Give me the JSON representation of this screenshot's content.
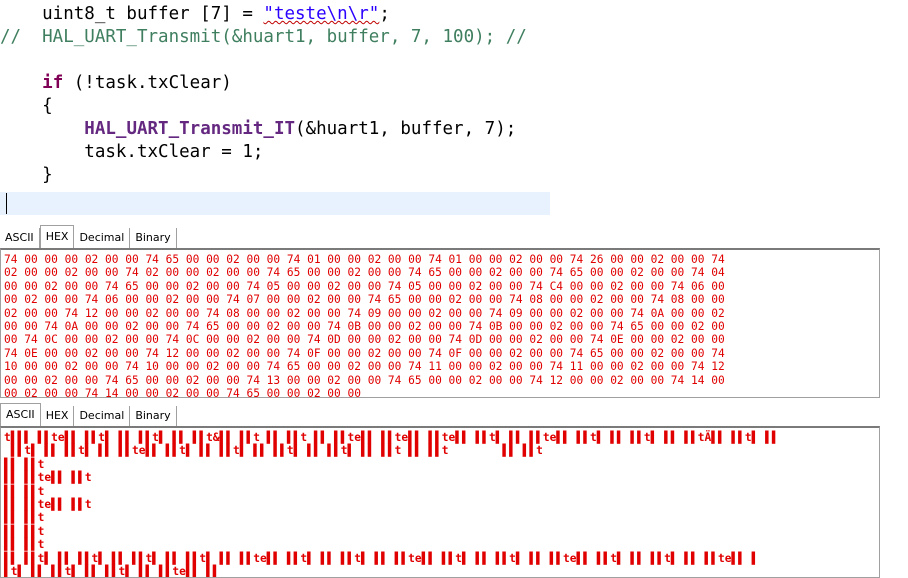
{
  "editor": {
    "lines": [
      [
        {
          "t": "    uint8_t buffer [7] = ",
          "c": "plain"
        },
        {
          "t": "\"teste\\n\\r\"",
          "c": "str-sq"
        },
        {
          "t": ";",
          "c": "plain"
        }
      ],
      [
        {
          "t": "//  HAL_UART_Transmit(&huart1, buffer, 7, 100); //",
          "c": "comment"
        }
      ],
      [
        {
          "t": "",
          "c": "plain"
        }
      ],
      [
        {
          "t": "    ",
          "c": "plain"
        },
        {
          "t": "if",
          "c": "kw"
        },
        {
          "t": " (!task.txClear)",
          "c": "plain"
        }
      ],
      [
        {
          "t": "    {",
          "c": "plain"
        }
      ],
      [
        {
          "t": "        ",
          "c": "plain"
        },
        {
          "t": "HAL_UART_Transmit_IT",
          "c": "fn"
        },
        {
          "t": "(&huart1, buffer, 7);",
          "c": "plain"
        }
      ],
      [
        {
          "t": "        task.txClear = 1;",
          "c": "plain"
        }
      ],
      [
        {
          "t": "    }",
          "c": "plain"
        }
      ],
      [
        {
          "t": "",
          "c": "plain"
        }
      ]
    ]
  },
  "hex_panel": {
    "tabs": [
      "ASCII",
      "HEX",
      "Decimal",
      "Binary"
    ],
    "active_tab": "HEX",
    "lines": [
      "74 00 00 00 02 00 00 74 65 00 00 02 00 00 74 01 00 00 02 00 00 74 01 00 00 02 00 00 74 26 00 00 02 00 00 74",
      "02 00 00 02 00 00 74 02 00 00 02 00 00 74 65 00 00 02 00 00 74 65 00 00 02 00 00 74 65 00 00 02 00 00 74 04",
      "00 00 02 00 00 74 65 00 00 02 00 00 74 05 00 00 02 00 00 74 05 00 00 02 00 00 74 C4 00 00 02 00 00 74 06 00",
      "00 02 00 00 74 06 00 00 02 00 00 74 07 00 00 02 00 00 74 65 00 00 02 00 00 74 08 00 00 02 00 00 74 08 00 00",
      "02 00 00 74 12 00 00 02 00 00 74 08 00 00 02 00 00 74 09 00 00 02 00 00 74 09 00 00 02 00 00 74 0A 00 00 02",
      "00 00 74 0A 00 00 02 00 00 74 65 00 00 02 00 00 74 0B 00 00 02 00 00 74 0B 00 00 02 00 00 74 65 00 00 02 00",
      "00 74 0C 00 00 02 00 00 74 0C 00 00 02 00 00 74 0D 00 00 02 00 00 74 0D 00 00 02 00 00 74 0E 00 00 02 00 00",
      "74 0E 00 00 02 00 00 74 12 00 00 02 00 00 74 0F 00 00 02 00 00 74 0F 00 00 02 00 00 74 65 00 00 02 00 00 74",
      "10 00 00 02 00 00 74 10 00 00 02 00 00 74 65 00 00 02 00 00 74 11 00 00 02 00 00 74 11 00 00 02 00 00 74 12",
      "00 00 02 00 00 74 65 00 00 02 00 00 74 13 00 00 02 00 00 74 65 00 00 02 00 00 74 12 00 00 02 00 00 74 14 00",
      "00 02 00 00 74 14 00 00 02 00 00 74 65 00 00 02 00 00"
    ]
  },
  "ascii_panel": {
    "tabs": [
      "ASCII",
      "HEX",
      "Decimal",
      "Binary"
    ],
    "active_tab": "ASCII",
    "lines": [
      "t▌▌▌ ▌▌te▌▌ ▌▌t▌ ▌▌ ▌▌t▌ ▌▌ ▌▌t&▌▌ ▌▌t ▌▌ ▌▌t ▌▌ ▌▌te▌▌ ▌▌te▌▌ ▌▌te▌▌ ▌▌t▌ ▌▌ ▌▌te▌▌ ▌▌t▌ ▌▌ ▌▌t▌ ▌▌ ▌▌tÄ▌▌ ▌▌t▌ ▌▌",
      " ▌▌t▌ ▌▌ ▌▌t▌ ▌▌ ▌▌te▌▌ ▌▌t▌ ▌▌ ▌▌t▌ ▌▌ ▌▌t▌ ▌▌ ▌▌t▌ ▌▌ ▌▌t ▌▌ ▌▌t        ▌▌ ▌▌t",
      "▌▌ ▌▌t",
      "▌▌ ▌▌te▌▌ ▌▌t",
      "▌▌ ▌▌t",
      "▌▌ ▌▌te▌▌ ▌▌t",
      "▌▌ ▌▌t",
      "▌▌ ▌▌t",
      "▌▌ ▌▌t",
      "▌▌ ▌▌t▌ ▌▌ ▌▌t▌ ▌▌ ▌▌t▌ ▌▌ ▌▌t▌ ▌▌ ▌▌te▌▌ ▌▌t▌ ▌▌ ▌▌t▌ ▌▌ ▌▌te▌▌ ▌▌t▌ ▌▌ ▌▌t▌ ▌▌ ▌▌te▌▌ ▌▌t▌ ▌▌ ▌▌t▌ ▌▌ ▌▌te▌▌ ▌",
      "▌t▌ ▌▌ ▌▌t▌ ▌▌ ▌▌t▌ ▌▌ ▌▌te▌▌ ▌▌"
    ]
  }
}
